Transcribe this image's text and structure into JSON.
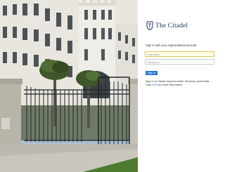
{
  "brand": {
    "name": "The Citadel",
    "color": "#1c2f55"
  },
  "signin": {
    "prompt": "Sign in with your organizational account",
    "username_placeholder": "Username",
    "password_placeholder": "Password",
    "button_label": "Sign in",
    "button_color": "#2b74d6",
    "help_line": "Sign in to Citadel requires Active Directory credentials.",
    "help_prefix": "Click",
    "help_link": "here",
    "help_suffix": "for more information."
  },
  "background": {
    "subject": "Citadel barracks building with iron gate and palm trees"
  }
}
